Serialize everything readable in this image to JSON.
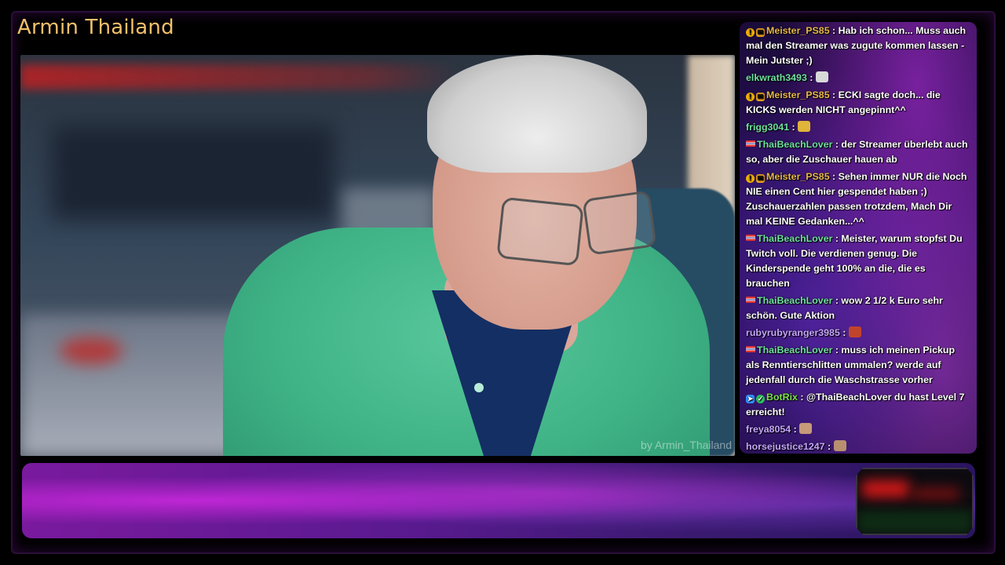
{
  "channel": {
    "title": "Armin Thailand"
  },
  "video": {
    "watermark": "by Armin_Thailand"
  },
  "colors": {
    "title": "#f3c06a",
    "chat_name_gold": "#e7b64a",
    "chat_name_green": "#6fe0a0",
    "chat_name_purple": "#c7a6ff",
    "chat_name_teal": "#6fd3e6",
    "banner_accent": "#b020d0"
  },
  "chat": {
    "messages": [
      {
        "user": "Meister_PS85",
        "badges": [
          "warn",
          "gift"
        ],
        "color": "#e7b64a",
        "text": "Hab ich schon... Muss auch mal den Streamer was zugute kommen lassen - Mein Jutster ;)"
      },
      {
        "user": "elkwrath3493",
        "badges": [],
        "color": "#6fe0a0",
        "text": "",
        "emote": "hands-emote"
      },
      {
        "user": "Meister_PS85",
        "badges": [
          "warn",
          "gift"
        ],
        "color": "#e7b64a",
        "text": "ECKI sagte doch... die KICKS werden NICHT angepinnt^^"
      },
      {
        "user": "frigg3041",
        "badges": [],
        "color": "#6fe0a0",
        "text": "",
        "emote": "crown-emote"
      },
      {
        "user": "ThaiBeachLover",
        "badges": [
          "flag"
        ],
        "color": "#6fe0a0",
        "text": "der Streamer überlebt auch so, aber die Zuschauer hauen ab"
      },
      {
        "user": "Meister_PS85",
        "badges": [
          "warn",
          "gift"
        ],
        "color": "#e7b64a",
        "text": "Sehen immer NUR die Noch NIE einen Cent hier gespendet haben ;) Zuschauerzahlen passen trotzdem, Mach Dir mal KEINE Gedanken...^^"
      },
      {
        "user": "ThaiBeachLover",
        "badges": [
          "flag"
        ],
        "color": "#6fe0a0",
        "text": "Meister, warum stopfst Du Twitch voll. Die verdienen genug. Die Kinderspende geht 100% an die, die es brauchen"
      },
      {
        "user": "ThaiBeachLover",
        "badges": [
          "flag"
        ],
        "color": "#6fe0a0",
        "text": "wow 2 1/2 k Euro sehr schön. Gute Aktion"
      },
      {
        "user": "rubyrubyranger3985",
        "badges": [],
        "color": "#c7a6ff",
        "text": "",
        "emote": "ruby-emote"
      },
      {
        "user": "ThaiBeachLover",
        "badges": [
          "flag"
        ],
        "color": "#6fe0a0",
        "text": "muss ich meinen Pickup als Rennt­ierschlitten ummalen? werde auf jedenfall durch die Waschstrasse vorher"
      },
      {
        "user": "BotRix",
        "badges": [
          "bot",
          "check"
        ],
        "color": "#7be04a",
        "text": "@ThaiBeachLover du hast Level 7 erreicht!"
      },
      {
        "user": "freya8054",
        "badges": [],
        "color": "#c7a6ff",
        "text": "",
        "emote": "cat-emote"
      },
      {
        "user": "horsejustice1247",
        "badges": [],
        "color": "#c7a6ff",
        "text": "",
        "emote": "pug-emote"
      }
    ]
  }
}
